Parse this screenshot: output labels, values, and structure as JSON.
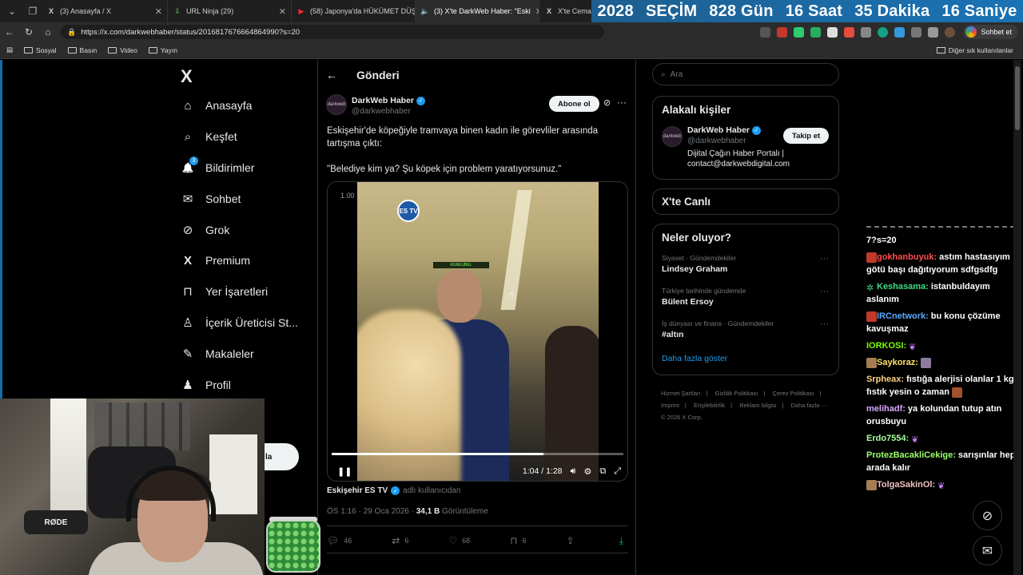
{
  "browser": {
    "tabs": [
      {
        "icon": "X",
        "title": "(3) Anasayfa / X",
        "active": false
      },
      {
        "icon": "⇩",
        "title": "URL Ninja (29)",
        "active": false
      },
      {
        "icon": "▶",
        "title": "(58) Japonya'da HÜKÜMET DÜŞT",
        "active": false
      },
      {
        "icon": "X",
        "title": "(3) X'te DarkWeb Haber: \"Eski",
        "active": true
      },
      {
        "icon": "X",
        "title": "X'te Cemal Er",
        "active": false
      }
    ],
    "countdown": [
      "2028",
      "SEÇİM",
      "828 Gün",
      "16 Saat",
      "35 Dakika",
      "16 Saniye"
    ],
    "url": "https://x.com/darkwebhaber/status/2016817676664864990?s=20",
    "chat_button": "Sohbet et",
    "bookmarks": [
      "Sosyal",
      "Basın",
      "Video",
      "Yayın"
    ],
    "bookmarks_right": "Diğer sık kullanılanlar"
  },
  "nav": {
    "logo": "X",
    "items": [
      {
        "icon": "⌂",
        "label": "Anasayfa"
      },
      {
        "icon": "⌕",
        "label": "Keşfet"
      },
      {
        "icon": "🔔",
        "label": "Bildirimler",
        "badge": "3"
      },
      {
        "icon": "✉",
        "label": "Sohbet"
      },
      {
        "icon": "⊘",
        "label": "Grok"
      },
      {
        "icon": "X",
        "label": "Premium"
      },
      {
        "icon": "⊓",
        "label": "Yer İşaretleri"
      },
      {
        "icon": "♙",
        "label": "İçerik Üreticisi St..."
      },
      {
        "icon": "✎",
        "label": "Makaleler"
      },
      {
        "icon": "♟",
        "label": "Profil"
      }
    ],
    "post_fragment": "la"
  },
  "main": {
    "header": "Gönderi",
    "author": {
      "avatar_text": "darkweb",
      "name": "DarkWeb Haber",
      "handle": "@darkwebhaber",
      "subscribe": "Abone ol"
    },
    "text_lines": [
      "Eskişehir'de köpeğiyle tramvaya binen kadın ile görevliler arasında tartışma çıktı:",
      "\"Belediye kim ya? Şu köpek için problem yaratıyorsunuz.\""
    ],
    "video": {
      "speed": "1.00",
      "logo": "ES TV",
      "sign": "KUMLUBEL",
      "time": "1:04 / 1:28",
      "progress": 0.727
    },
    "credit": {
      "name": "Eskişehir ES TV",
      "suffix": "adlı kullanıcıdan"
    },
    "meta": {
      "time": "ÖS 1:16 · 29 Oca 2026 · ",
      "views": "34,1 B",
      "views_label": " Görüntüleme"
    },
    "actions": {
      "replies": "46",
      "reposts": "6",
      "likes": "68",
      "bookmarks": "6"
    }
  },
  "right": {
    "search_placeholder": "Ara",
    "related_title": "Alakalı kişiler",
    "related": {
      "avatar_text": "darkweb",
      "name": "DarkWeb Haber",
      "handle": "@darkwebhaber",
      "bio": "Dijital Çağın Haber Portalı | contact@darkwebdigital.com",
      "follow": "Takip et"
    },
    "live_title": "X'te Canlı",
    "trends_title": "Neler oluyor?",
    "trends": [
      {
        "category": "Siyaset · Gündemdekiler",
        "title": "Lindsey Graham"
      },
      {
        "category": "Türkiye tarihinde gündemde",
        "title": "Bülent Ersoy"
      },
      {
        "category": "İş dünyası ve finans · Gündemdekiler",
        "title": "#altın"
      }
    ],
    "show_more": "Daha fazla göster",
    "footer": [
      "Hizmet Şartları",
      "|",
      "Gizlilik Politikası",
      "|",
      "Çerez Politikası",
      "|",
      "Imprint",
      "|",
      "Erişilebilirlik",
      "|",
      "Reklam bilgisi",
      "|",
      "Daha fazla ···",
      "© 2026 X Corp."
    ]
  },
  "chat": {
    "partial_line": "7?s=20",
    "messages": [
      {
        "user": "gokhanbuyuk:",
        "color": "#ff4d4d",
        "text": "astım hastasıyım götü başı dağıtıyorum sdfgsdfg"
      },
      {
        "user": "Keshasama:",
        "color": "#3ddc84",
        "text": "istanbuldayım aslanım"
      },
      {
        "user": "IRCnetwork:",
        "color": "#5aa9ff",
        "text": "bu konu çözüme kavuşmaz"
      },
      {
        "user": "IORKOSI:",
        "color": "#7cfc00",
        "text": ""
      },
      {
        "user": "Saykoraz:",
        "color": "#ffe066",
        "text": ""
      },
      {
        "user": "Srpheax:",
        "color": "#ffd27f",
        "text": "fıstığa alerjisi olanlar 1 kg fıstık yesin o zaman"
      },
      {
        "user": "melihadf:",
        "color": "#d9a8ff",
        "text": "ya kolundan tutup atın orusbuyu"
      },
      {
        "user": "Erdo7554:",
        "color": "#a8ff9e",
        "text": ""
      },
      {
        "user": "ProtezBacakliCekige:",
        "color": "#9cff6e",
        "text": "sarışınlar hep arada kalır"
      },
      {
        "user": "TolgaSakinOl:",
        "color": "#f0c0c0",
        "text": ""
      }
    ]
  },
  "webcam": {
    "mic_label": "RØDE"
  }
}
